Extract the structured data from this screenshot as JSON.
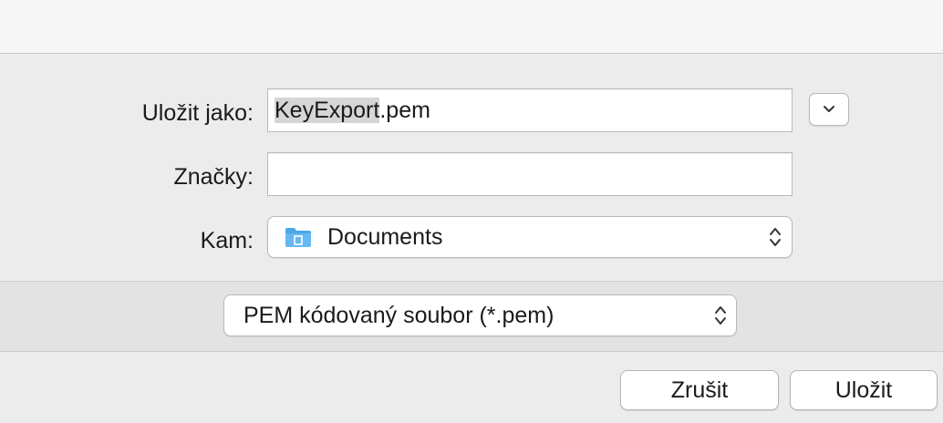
{
  "dialog": {
    "save_as": {
      "label": "Uložit jako:",
      "value_selected": "KeyExport",
      "value_extension": ".pem"
    },
    "tags": {
      "label": "Značky:",
      "value": ""
    },
    "where": {
      "label": "Kam:",
      "value": "Documents",
      "icon": "folder-icon"
    },
    "expand_icon": "chevron-down-icon",
    "format": {
      "value": "PEM kódovaný soubor (*.pem)"
    },
    "buttons": {
      "cancel": "Zrušit",
      "save": "Uložit"
    }
  },
  "colors": {
    "folder": "#4aa8e8",
    "selection": "#d6d6d6"
  }
}
